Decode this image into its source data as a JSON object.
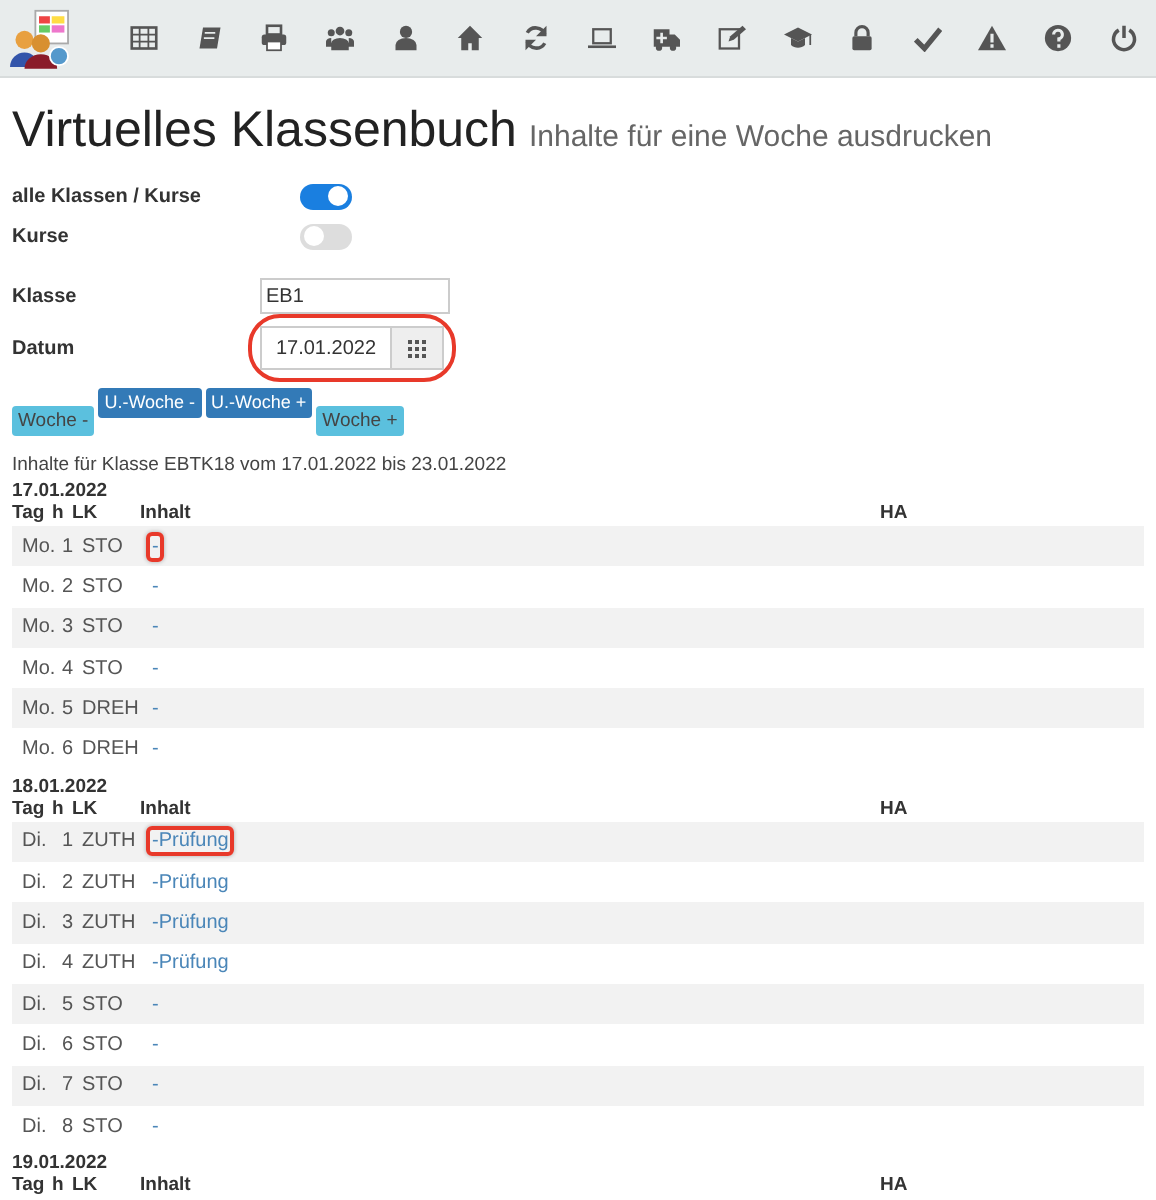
{
  "toolbar": {
    "icons": [
      {
        "kind": "table"
      },
      {
        "kind": "book"
      },
      {
        "kind": "print"
      },
      {
        "kind": "group"
      },
      {
        "kind": "user"
      },
      {
        "kind": "home"
      },
      {
        "kind": "refresh"
      },
      {
        "kind": "laptop"
      },
      {
        "kind": "ambulance"
      },
      {
        "kind": "edit"
      },
      {
        "kind": "cap"
      },
      {
        "kind": "lock"
      },
      {
        "kind": "check"
      },
      {
        "kind": "warning"
      },
      {
        "kind": "question"
      },
      {
        "kind": "power"
      }
    ]
  },
  "title": "Virtuelles Klassenbuch",
  "subtitle": "Inhalte für eine Woche ausdrucken",
  "toggles": [
    {
      "label": "alle Klassen / Kurse",
      "on": true
    },
    {
      "label": "Kurse",
      "on": false
    }
  ],
  "klasse": {
    "label": "Klasse",
    "value": "EB1"
  },
  "datum": {
    "label": "Datum",
    "value": "17.01.2022",
    "highlighted": true
  },
  "buttons": [
    {
      "label": "Woche -",
      "kind": "info"
    },
    {
      "label": "U.-Woche -",
      "kind": "primary"
    },
    {
      "label": "U.-Woche +",
      "kind": "primary"
    },
    {
      "label": "Woche +",
      "kind": "info"
    }
  ],
  "info": "Inhalte für Klasse EBTK18 vom 17.01.2022 bis 23.01.2022",
  "days": [
    {
      "date": "17.01.2022",
      "columns": [
        "Tag",
        "h",
        "LK",
        "Inhalt",
        "HA"
      ],
      "rows": [
        {
          "tag": "Mo.",
          "h": "1",
          "lk": "STO",
          "inhalt": "-",
          "highlighted": true
        },
        {
          "tag": "Mo.",
          "h": "2",
          "lk": "STO",
          "inhalt": "-",
          "highlighted": false
        },
        {
          "tag": "Mo.",
          "h": "3",
          "lk": "STO",
          "inhalt": "-",
          "highlighted": false
        },
        {
          "tag": "Mo.",
          "h": "4",
          "lk": "STO",
          "inhalt": "-",
          "highlighted": false
        },
        {
          "tag": "Mo.",
          "h": "5",
          "lk": "DREH",
          "inhalt": "-",
          "highlighted": false
        },
        {
          "tag": "Mo.",
          "h": "6",
          "lk": "DREH",
          "inhalt": "-",
          "highlighted": false
        }
      ]
    },
    {
      "date": "18.01.2022",
      "columns": [
        "Tag",
        "h",
        "LK",
        "Inhalt",
        "HA"
      ],
      "rows": [
        {
          "tag": "Di.",
          "h": "1",
          "lk": "ZUTH",
          "inhalt": "-Prüfung",
          "highlighted": true
        },
        {
          "tag": "Di.",
          "h": "2",
          "lk": "ZUTH",
          "inhalt": "-Prüfung",
          "highlighted": false
        },
        {
          "tag": "Di.",
          "h": "3",
          "lk": "ZUTH",
          "inhalt": "-Prüfung",
          "highlighted": false
        },
        {
          "tag": "Di.",
          "h": "4",
          "lk": "ZUTH",
          "inhalt": "-Prüfung",
          "highlighted": false
        },
        {
          "tag": "Di.",
          "h": "5",
          "lk": "STO",
          "inhalt": "-",
          "highlighted": false
        },
        {
          "tag": "Di.",
          "h": "6",
          "lk": "STO",
          "inhalt": "-",
          "highlighted": false
        },
        {
          "tag": "Di.",
          "h": "7",
          "lk": "STO",
          "inhalt": "-",
          "highlighted": false
        },
        {
          "tag": "Di.",
          "h": "8",
          "lk": "STO",
          "inhalt": "-",
          "highlighted": false
        }
      ]
    },
    {
      "date": "19.01.2022",
      "columns": [
        "Tag",
        "h",
        "LK",
        "Inhalt",
        "HA"
      ]
    }
  ]
}
